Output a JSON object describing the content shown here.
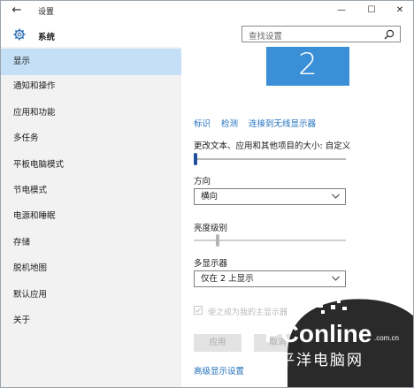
{
  "titlebar": {
    "back_glyph": "←",
    "title": "设置",
    "minimize": "—",
    "maximize": "☐",
    "close": "✕"
  },
  "header": {
    "title": "系统",
    "icon": "gear-icon",
    "search_placeholder": "查找设置"
  },
  "sidebar": {
    "items": [
      {
        "label": "显示",
        "selected": true
      },
      {
        "label": "通知和操作"
      },
      {
        "label": "应用和功能"
      },
      {
        "label": "多任务"
      },
      {
        "label": "平板电脑模式"
      },
      {
        "label": "节电模式"
      },
      {
        "label": "电源和睡眠"
      },
      {
        "label": "存储"
      },
      {
        "label": "脱机地图"
      },
      {
        "label": "默认应用"
      },
      {
        "label": "关于"
      }
    ]
  },
  "main": {
    "display_number": "2",
    "links": [
      "标识",
      "检测",
      "连接到无线显示器"
    ],
    "scale_label": "更改文本、应用和其他项目的大小: 自定义",
    "scale_level": 0,
    "orientation_label": "方向",
    "orientation_value": "横向",
    "brightness_label": "亮度级别",
    "brightness_level": 0.15,
    "multi_display_label": "多显示器",
    "multi_display_value": "仅在 2 上显示",
    "main_display_checkbox": "使之成为我的主显示器",
    "apply_button": "应用",
    "cancel_button": "取消",
    "advanced_link": "高级显示设置"
  },
  "watermark": {
    "logo": "PConline",
    "domain": ".com.cn",
    "tagline": "太平洋电脑网"
  },
  "colors": {
    "accent": "#3b8fd6",
    "selected_nav": "#c4dff6",
    "link": "#1f6fbd",
    "sidebar_bg": "#f2f2f2"
  }
}
